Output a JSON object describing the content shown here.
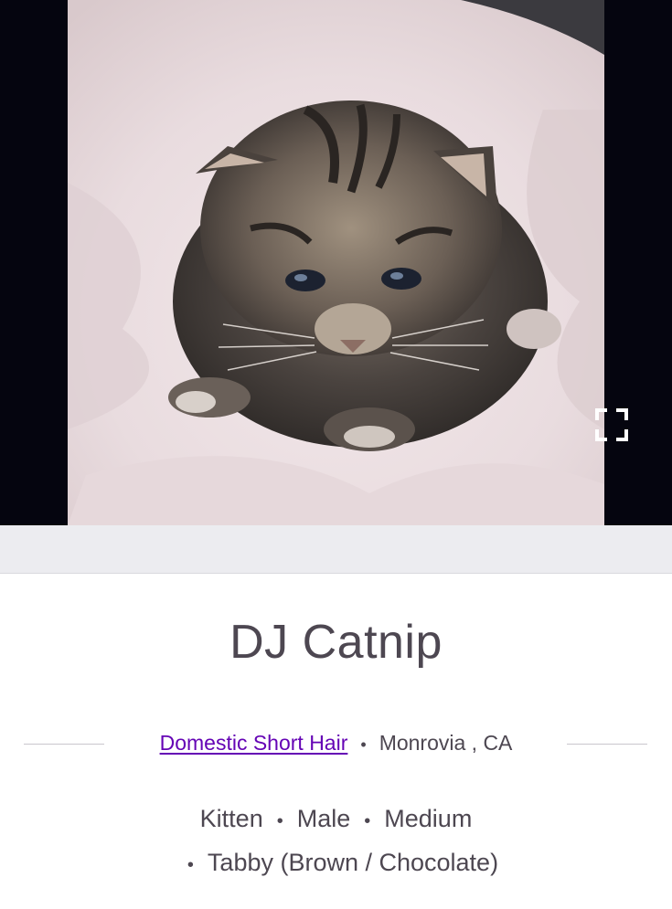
{
  "photo": {
    "alt": "Photo of DJ Catnip",
    "fullscreen_icon": "expand-icon"
  },
  "pet": {
    "name": "DJ Catnip",
    "breed": "Domestic Short Hair",
    "location": "Monrovia , CA",
    "age": "Kitten",
    "gender": "Male",
    "size": "Medium",
    "color": "Tabby (Brown / Chocolate)",
    "separator": "•"
  },
  "colors": {
    "link": "#6504b5",
    "text": "#4d4751",
    "band": "#ececf0"
  }
}
